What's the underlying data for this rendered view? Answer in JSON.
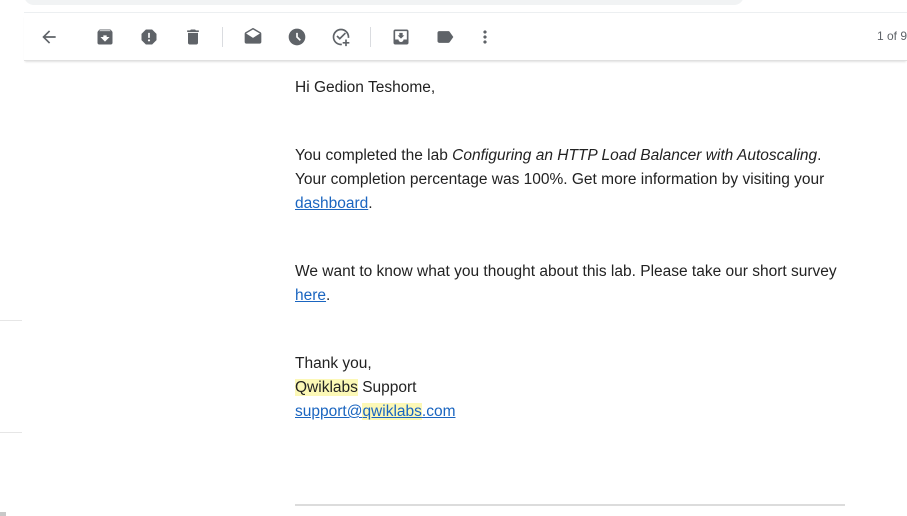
{
  "toolbar": {
    "buttons": [
      {
        "name": "back",
        "icon": "arrow-left-icon"
      },
      {
        "name": "archive",
        "icon": "archive-icon"
      },
      {
        "name": "report-spam",
        "icon": "report-spam-icon"
      },
      {
        "name": "delete",
        "icon": "trash-icon"
      },
      {
        "name": "mark-unread",
        "icon": "mark-unread-icon"
      },
      {
        "name": "snooze",
        "icon": "clock-icon"
      },
      {
        "name": "add-to-tasks",
        "icon": "add-task-icon"
      },
      {
        "name": "move-to",
        "icon": "move-to-inbox-icon"
      },
      {
        "name": "labels",
        "icon": "label-icon"
      },
      {
        "name": "more",
        "icon": "more-vert-icon"
      }
    ],
    "pager": "1 of 9"
  },
  "email": {
    "greeting": "Hi Gedion Teshome,",
    "completed_prefix": "You completed the lab ",
    "lab_name": "Configuring an HTTP Load Balancer with Autoscaling",
    "completed_suffix": ".",
    "percentage_text": "Your completion percentage was 100%. Get more information by visiting your ",
    "dashboard_link": "dashboard",
    "dashboard_suffix": ".",
    "survey_text": "We want to know what you thought about this lab. Please take our short survey ",
    "survey_link": "here",
    "survey_suffix": ".",
    "thanks": "Thank you,",
    "signature_brand": "Qwiklabs",
    "signature_rest": " Support",
    "email_user": "support@",
    "email_domain": "qwiklabs",
    "email_tld": ".com"
  },
  "colors": {
    "link": "#1a65c0",
    "highlight": "#fcf8b6",
    "icon": "#5f6368"
  }
}
